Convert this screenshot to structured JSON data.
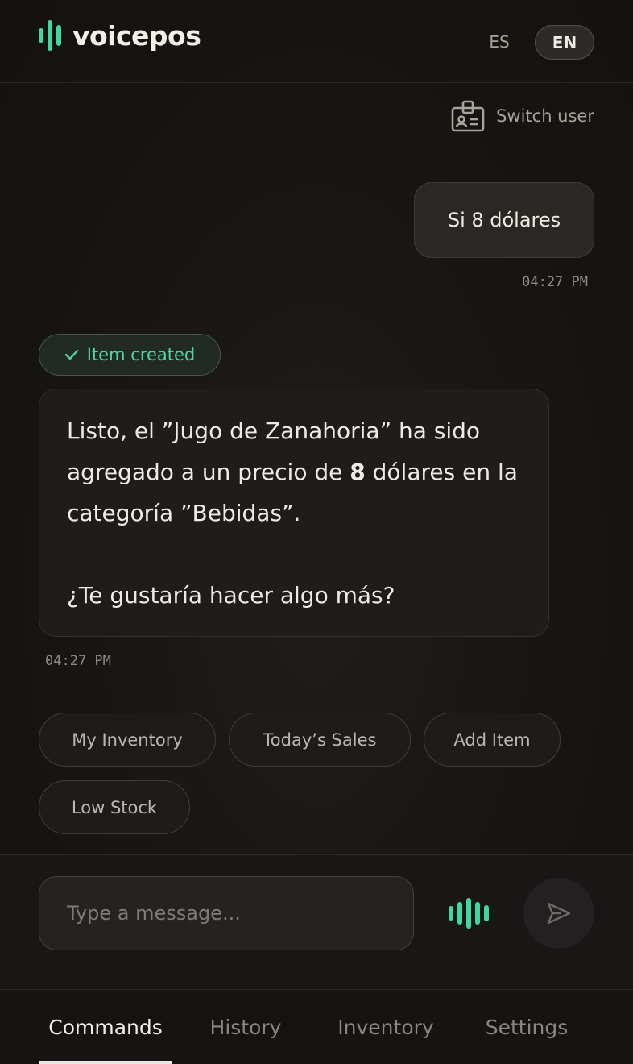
{
  "header": {
    "brand": "voicepos",
    "languages": {
      "es": "ES",
      "en": "EN",
      "active": "EN"
    }
  },
  "switch_user": {
    "label": "Switch user",
    "icon": "id-card-icon"
  },
  "messages": {
    "user": {
      "text": "Si 8 dólares",
      "time": "04:27 PM"
    },
    "bot": {
      "badge": "Item created",
      "badge_icon": "check-icon",
      "line1_before": "Listo, el ”Jugo de Zanahoria” ha sido agregado a un precio de ",
      "line1_bold": "8",
      "line1_after": " dólares en la categoría ”Bebidas”.",
      "line2": "¿Te gustaría hacer algo más?",
      "time": "04:27 PM"
    }
  },
  "quick_actions": [
    "My Inventory",
    "Today’s Sales",
    "Add Item",
    "Low Stock"
  ],
  "composer": {
    "placeholder": "Type a message...",
    "value": ""
  },
  "nav": {
    "tabs": [
      "Commands",
      "History",
      "Inventory",
      "Settings"
    ],
    "active": "Commands"
  },
  "colors": {
    "accent": "#3fd9a0",
    "background": "#161412",
    "bubble": "#2a2825",
    "text": "#efebe4",
    "muted": "#8e8a83"
  }
}
